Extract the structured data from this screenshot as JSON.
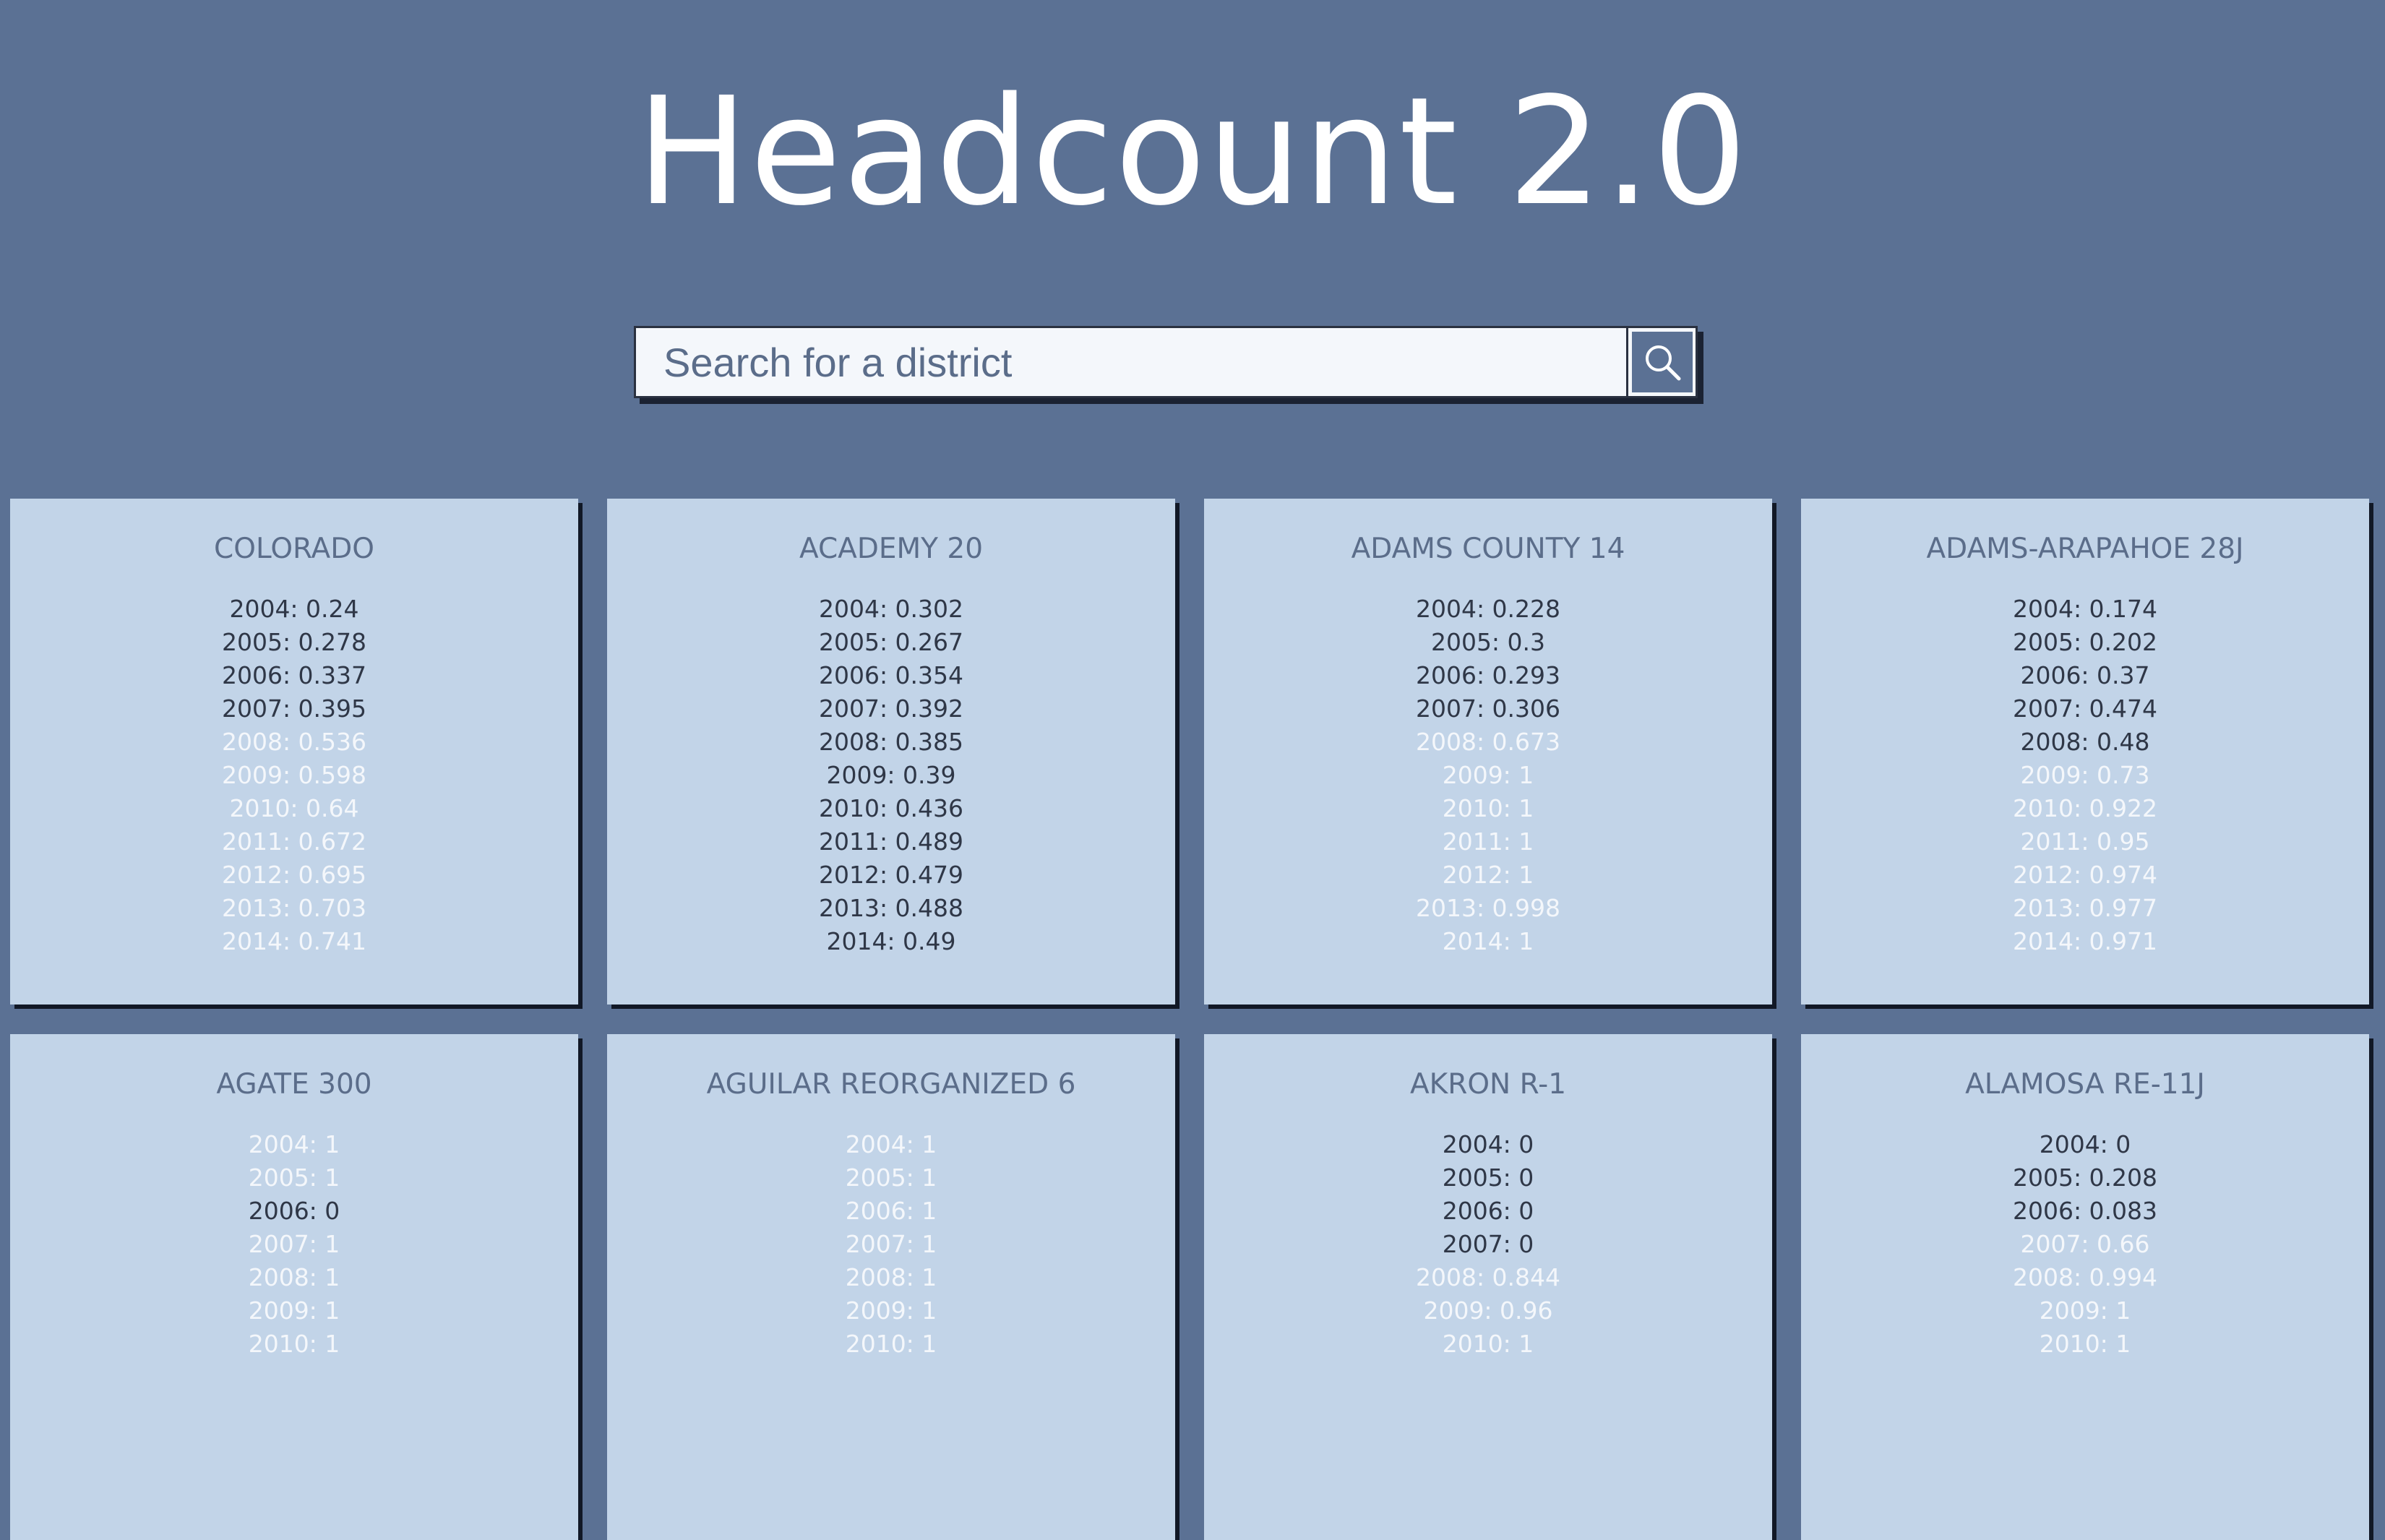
{
  "header": {
    "title": "Headcount 2.0"
  },
  "search": {
    "placeholder": "Search for a district",
    "icon": "search-icon"
  },
  "districts": [
    {
      "name": "COLORADO",
      "years": [
        {
          "label": "2004: 0.24",
          "hi": false
        },
        {
          "label": "2005: 0.278",
          "hi": false
        },
        {
          "label": "2006: 0.337",
          "hi": false
        },
        {
          "label": "2007: 0.395",
          "hi": false
        },
        {
          "label": "2008: 0.536",
          "hi": true
        },
        {
          "label": "2009: 0.598",
          "hi": true
        },
        {
          "label": "2010: 0.64",
          "hi": true
        },
        {
          "label": "2011: 0.672",
          "hi": true
        },
        {
          "label": "2012: 0.695",
          "hi": true
        },
        {
          "label": "2013: 0.703",
          "hi": true
        },
        {
          "label": "2014: 0.741",
          "hi": true
        }
      ]
    },
    {
      "name": "ACADEMY 20",
      "years": [
        {
          "label": "2004: 0.302",
          "hi": false
        },
        {
          "label": "2005: 0.267",
          "hi": false
        },
        {
          "label": "2006: 0.354",
          "hi": false
        },
        {
          "label": "2007: 0.392",
          "hi": false
        },
        {
          "label": "2008: 0.385",
          "hi": false
        },
        {
          "label": "2009: 0.39",
          "hi": false
        },
        {
          "label": "2010: 0.436",
          "hi": false
        },
        {
          "label": "2011: 0.489",
          "hi": false
        },
        {
          "label": "2012: 0.479",
          "hi": false
        },
        {
          "label": "2013: 0.488",
          "hi": false
        },
        {
          "label": "2014: 0.49",
          "hi": false
        }
      ]
    },
    {
      "name": "ADAMS COUNTY 14",
      "years": [
        {
          "label": "2004: 0.228",
          "hi": false
        },
        {
          "label": "2005: 0.3",
          "hi": false
        },
        {
          "label": "2006: 0.293",
          "hi": false
        },
        {
          "label": "2007: 0.306",
          "hi": false
        },
        {
          "label": "2008: 0.673",
          "hi": true
        },
        {
          "label": "2009: 1",
          "hi": true
        },
        {
          "label": "2010: 1",
          "hi": true
        },
        {
          "label": "2011: 1",
          "hi": true
        },
        {
          "label": "2012: 1",
          "hi": true
        },
        {
          "label": "2013: 0.998",
          "hi": true
        },
        {
          "label": "2014: 1",
          "hi": true
        }
      ]
    },
    {
      "name": "ADAMS-ARAPAHOE 28J",
      "years": [
        {
          "label": "2004: 0.174",
          "hi": false
        },
        {
          "label": "2005: 0.202",
          "hi": false
        },
        {
          "label": "2006: 0.37",
          "hi": false
        },
        {
          "label": "2007: 0.474",
          "hi": false
        },
        {
          "label": "2008: 0.48",
          "hi": false
        },
        {
          "label": "2009: 0.73",
          "hi": true
        },
        {
          "label": "2010: 0.922",
          "hi": true
        },
        {
          "label": "2011: 0.95",
          "hi": true
        },
        {
          "label": "2012: 0.974",
          "hi": true
        },
        {
          "label": "2013: 0.977",
          "hi": true
        },
        {
          "label": "2014: 0.971",
          "hi": true
        }
      ]
    },
    {
      "name": "AGATE 300",
      "years": [
        {
          "label": "2004: 1",
          "hi": true
        },
        {
          "label": "2005: 1",
          "hi": true
        },
        {
          "label": "2006: 0",
          "hi": false
        },
        {
          "label": "2007: 1",
          "hi": true
        },
        {
          "label": "2008: 1",
          "hi": true
        },
        {
          "label": "2009: 1",
          "hi": true
        },
        {
          "label": "2010: 1",
          "hi": true
        }
      ]
    },
    {
      "name": "AGUILAR REORGANIZED 6",
      "years": [
        {
          "label": "2004: 1",
          "hi": true
        },
        {
          "label": "2005: 1",
          "hi": true
        },
        {
          "label": "2006: 1",
          "hi": true
        },
        {
          "label": "2007: 1",
          "hi": true
        },
        {
          "label": "2008: 1",
          "hi": true
        },
        {
          "label": "2009: 1",
          "hi": true
        },
        {
          "label": "2010: 1",
          "hi": true
        }
      ]
    },
    {
      "name": "AKRON R-1",
      "years": [
        {
          "label": "2004: 0",
          "hi": false
        },
        {
          "label": "2005: 0",
          "hi": false
        },
        {
          "label": "2006: 0",
          "hi": false
        },
        {
          "label": "2007: 0",
          "hi": false
        },
        {
          "label": "2008: 0.844",
          "hi": true
        },
        {
          "label": "2009: 0.96",
          "hi": true
        },
        {
          "label": "2010: 1",
          "hi": true
        }
      ]
    },
    {
      "name": "ALAMOSA RE-11J",
      "years": [
        {
          "label": "2004: 0",
          "hi": false
        },
        {
          "label": "2005: 0.208",
          "hi": false
        },
        {
          "label": "2006: 0.083",
          "hi": false
        },
        {
          "label": "2007: 0.66",
          "hi": true
        },
        {
          "label": "2008: 0.994",
          "hi": true
        },
        {
          "label": "2009: 1",
          "hi": true
        },
        {
          "label": "2010: 1",
          "hi": true
        }
      ]
    }
  ]
}
